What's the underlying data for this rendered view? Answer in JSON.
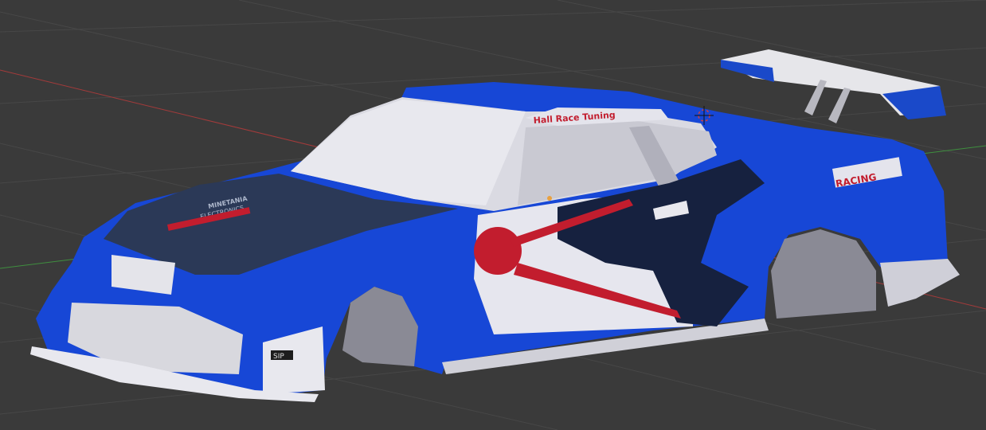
{
  "viewport": {
    "name": "3D Viewport",
    "background": "#3a3a3a",
    "grid_color": "#4a4a4a",
    "x_axis_color": "#a33a3a",
    "y_axis_color": "#3f8f3f"
  },
  "model": {
    "body_color": "#1747d6",
    "decals": {
      "roof_banner": "Hall Race Tuning",
      "side_badge": "RACING",
      "hood_brand": "MINETANIA",
      "hood_sub": "ELECTRONICS",
      "front_plate": "SIP"
    }
  }
}
